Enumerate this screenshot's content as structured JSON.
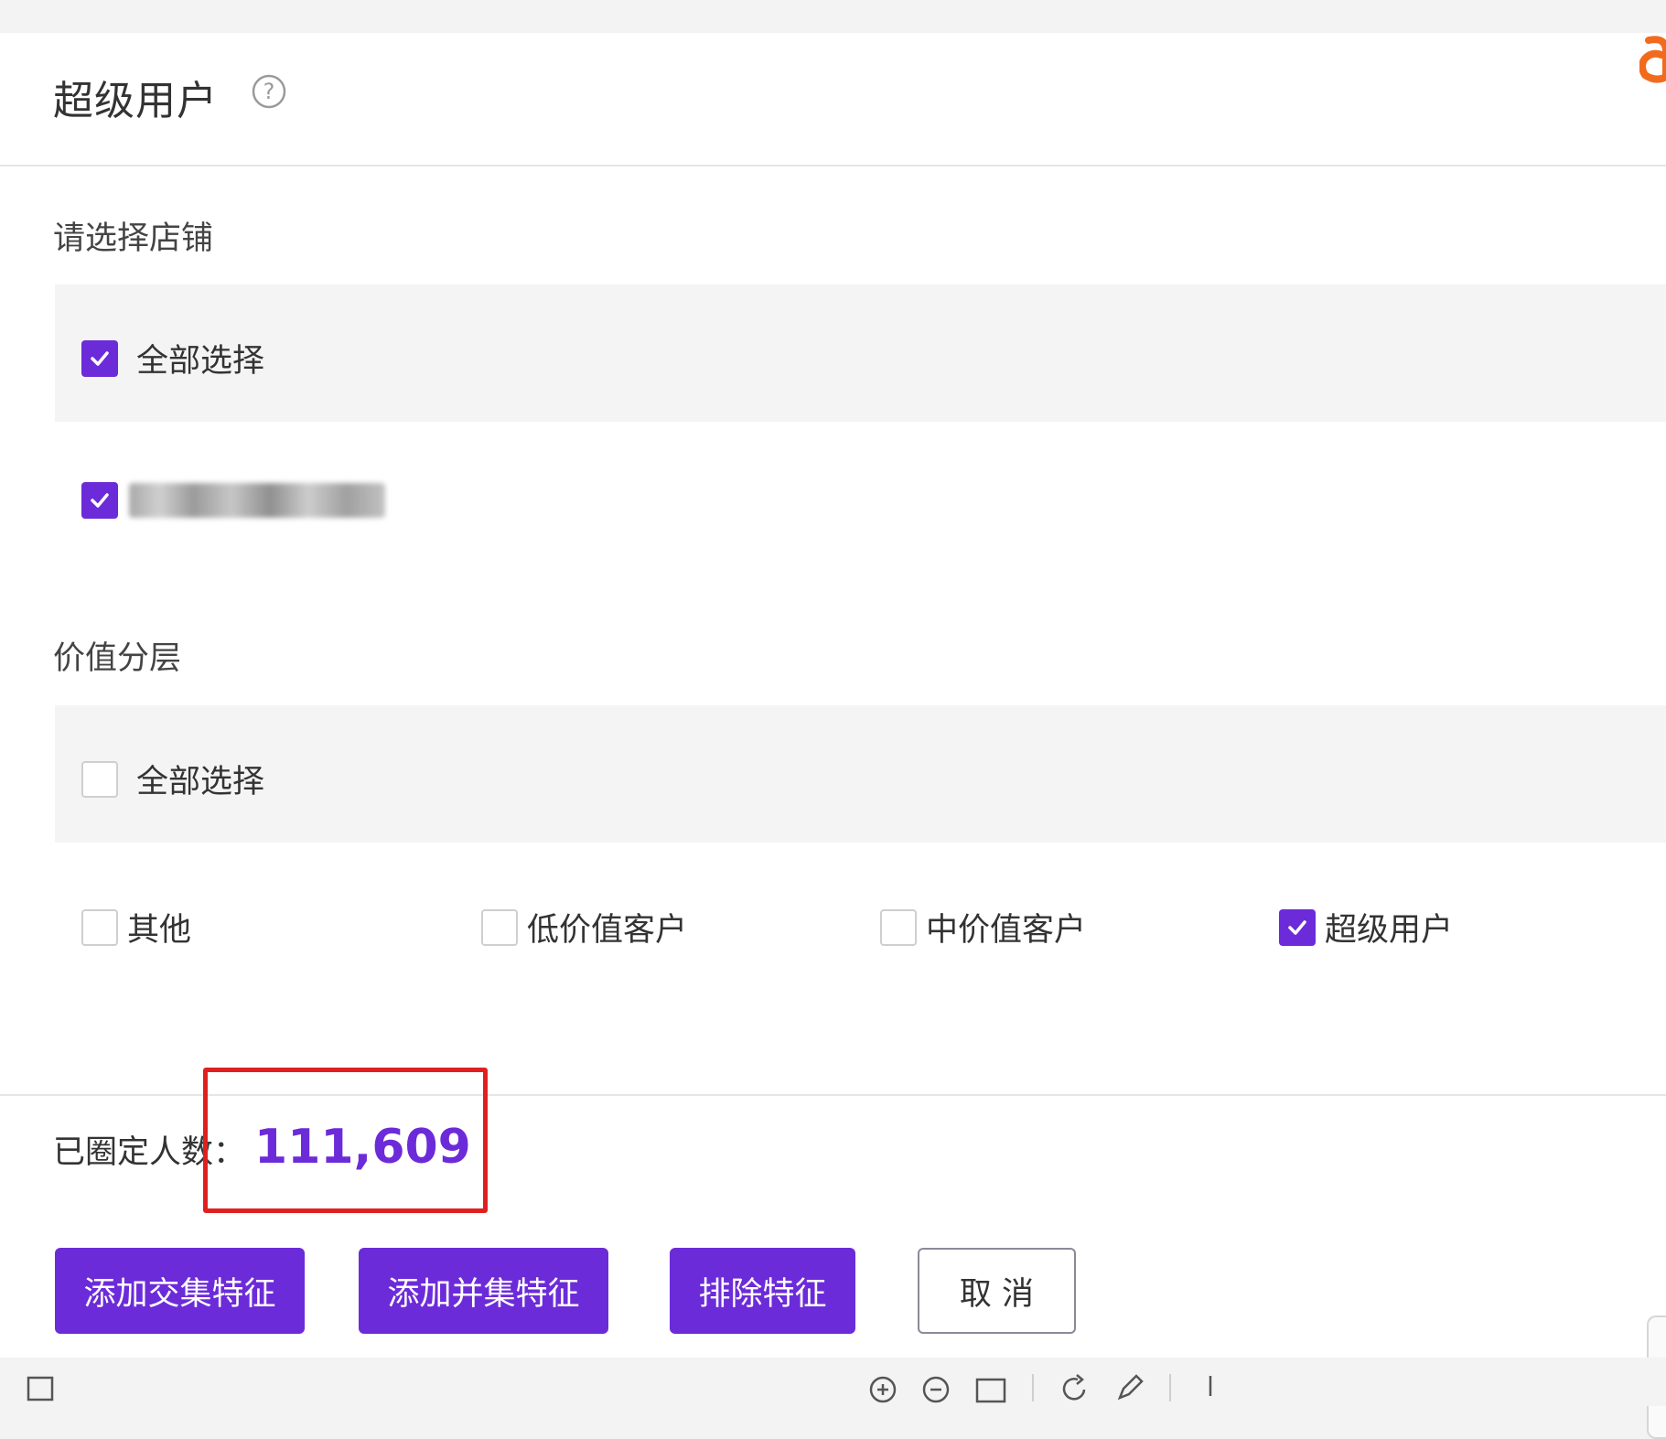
{
  "header": {
    "title": "超级用户",
    "help_icon": "question-circle-icon"
  },
  "store_section": {
    "label": "请选择店铺",
    "select_all": {
      "label": "全部选择",
      "checked": true
    },
    "stores": [
      {
        "label": "(blurred store name)",
        "checked": true
      }
    ]
  },
  "value_section": {
    "label": "价值分层",
    "select_all": {
      "label": "全部选择",
      "checked": false
    },
    "options": [
      {
        "label": "其他",
        "checked": false
      },
      {
        "label": "低价值客户",
        "checked": false
      },
      {
        "label": "中价值客户",
        "checked": false
      },
      {
        "label": "超级用户",
        "checked": true
      }
    ]
  },
  "summary": {
    "label": "已圈定人数：",
    "count": "111,609"
  },
  "actions": {
    "add_intersection": "添加交集特征",
    "add_union": "添加并集特征",
    "exclude": "排除特征",
    "cancel": "取 消"
  },
  "colors": {
    "accent": "#6c2bd9",
    "highlight_border": "#e02020"
  }
}
